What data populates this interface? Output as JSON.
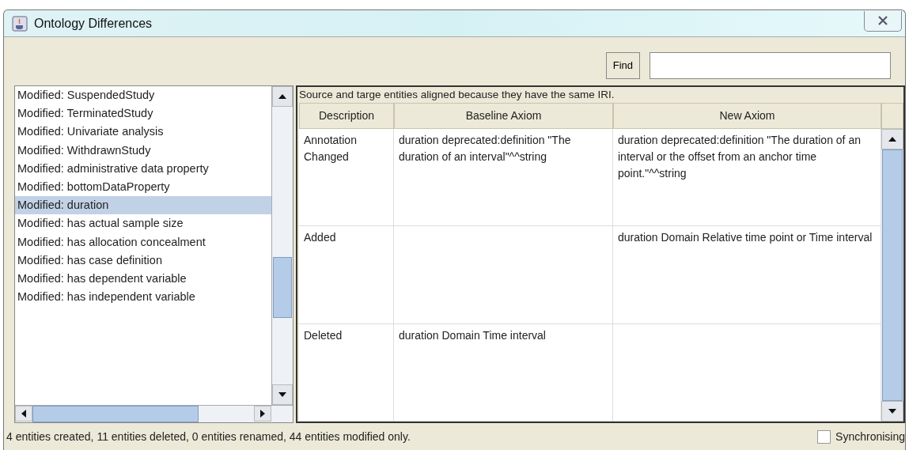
{
  "window": {
    "title": "Ontology Differences"
  },
  "toolbar": {
    "find_button": "Find"
  },
  "entity_list": {
    "items": [
      {
        "label": "Modified: SuspendedStudy",
        "selected": false
      },
      {
        "label": "Modified: TerminatedStudy",
        "selected": false
      },
      {
        "label": "Modified: Univariate analysis",
        "selected": false
      },
      {
        "label": "Modified: WithdrawnStudy",
        "selected": false
      },
      {
        "label": "Modified: administrative data property",
        "selected": false
      },
      {
        "label": "Modified: bottomDataProperty",
        "selected": false
      },
      {
        "label": "Modified: duration",
        "selected": true
      },
      {
        "label": "Modified: has actual sample size",
        "selected": false
      },
      {
        "label": "Modified: has allocation concealment",
        "selected": false
      },
      {
        "label": "Modified: has case definition",
        "selected": false
      },
      {
        "label": "Modified: has dependent variable",
        "selected": false
      },
      {
        "label": "Modified: has independent variable",
        "selected": false
      }
    ]
  },
  "details": {
    "caption": "Source and targe entities aligned because they have the same IRI.",
    "columns": [
      "Description",
      "Baseline Axiom",
      "New Axiom"
    ],
    "rows": [
      {
        "description": "Annotation Changed",
        "baseline_axiom": "duration deprecated:definition \"The duration of an interval\"^^string",
        "new_axiom": "duration deprecated:definition \"The duration of an interval or the offset from an anchor time point.\"^^string"
      },
      {
        "description": "Added",
        "new_axiom": "duration Domain Relative time point or Time interval"
      },
      {
        "description": "Deleted",
        "baseline_axiom": "duration Domain Time interval"
      }
    ]
  },
  "status_bar": {
    "text": "4 entities created, 11 entities deleted, 0 entities renamed, 44 entities modified only.",
    "synchronising": {
      "label": "Synchronising",
      "checked": false
    }
  }
}
